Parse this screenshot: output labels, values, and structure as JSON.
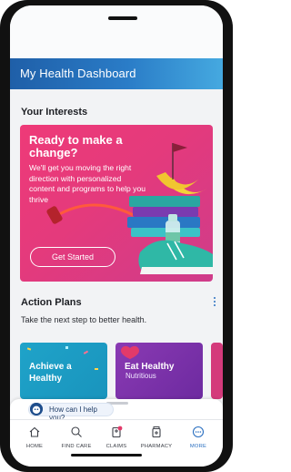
{
  "header": {
    "title": "My Health Dashboard"
  },
  "interests": {
    "title": "Your Interests",
    "hero": {
      "headline": "Ready to make a change?",
      "body": "We'll get you moving the right direction with personalized content and programs to help you thrive",
      "cta": "Get Started"
    }
  },
  "action_plans": {
    "title": "Action Plans",
    "subtitle": "Take the next step to better health.",
    "cards": [
      {
        "title": "Achieve a Healthy",
        "subtitle": ""
      },
      {
        "title": "Eat Healthy",
        "subtitle": "Nutritious"
      }
    ]
  },
  "help": {
    "label": "How can I help you?"
  },
  "tabs": [
    {
      "label": "HOME",
      "icon": "home-icon",
      "active": false
    },
    {
      "label": "FIND CARE",
      "icon": "search-icon",
      "active": false
    },
    {
      "label": "CLAIMS",
      "icon": "claims-icon",
      "active": false
    },
    {
      "label": "PHARMACY",
      "icon": "pharmacy-icon",
      "active": false
    },
    {
      "label": "MORE",
      "icon": "more-icon",
      "active": true
    }
  ],
  "colors": {
    "header_start": "#1f5fa8",
    "header_end": "#45a9e0",
    "hero": "#e43a7c",
    "accent": "#2a6fc0",
    "badge": "#e23a6a"
  }
}
